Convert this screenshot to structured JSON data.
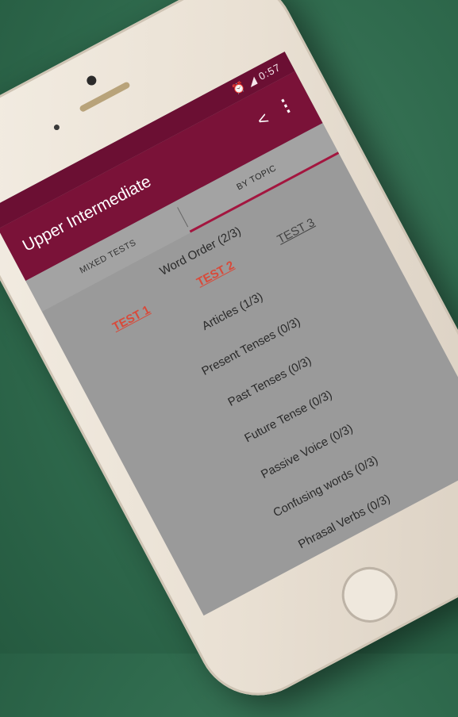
{
  "status_bar": {
    "time": "0:57",
    "icons": [
      "alarm-icon",
      "signal-icon"
    ]
  },
  "app_bar": {
    "title": "Upper Intermediate",
    "share_icon": "share-icon",
    "menu_icon": "more-vert-icon"
  },
  "tabs": [
    {
      "label": "MIXED TESTS",
      "active": false
    },
    {
      "label": "BY TOPIC",
      "active": true
    }
  ],
  "topics": [
    {
      "label": "Word Order (2/3)",
      "tests": [
        "TEST 1",
        "TEST 2",
        "TEST 3"
      ]
    },
    {
      "label": "Articles (1/3)"
    },
    {
      "label": "Present Tenses (0/3)"
    },
    {
      "label": "Past Tenses (0/3)"
    },
    {
      "label": "Future Tense (0/3)"
    },
    {
      "label": "Passive Voice (0/3)"
    },
    {
      "label": "Confusing words (0/3)"
    },
    {
      "label": "Phrasal Verbs (0/3)"
    }
  ],
  "colors": {
    "app_bar": "#7a1238",
    "status_bar": "#6b0f33",
    "screen_bg": "#9a9a9a",
    "done_test": "#d84a3a"
  }
}
